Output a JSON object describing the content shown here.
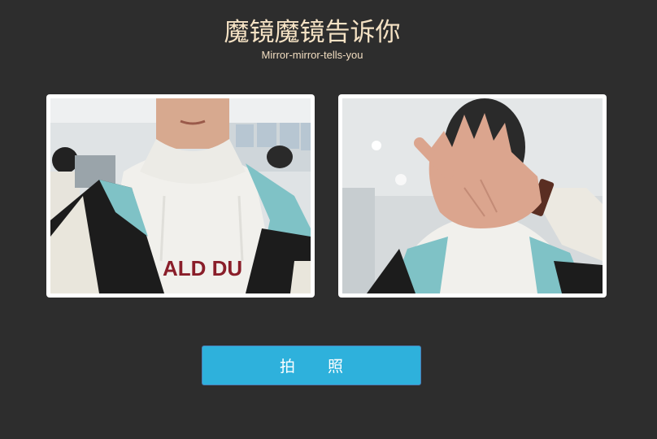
{
  "header": {
    "title": "魔镜魔镜告诉你",
    "subtitle": "Mirror-mirror-tells-you"
  },
  "camera": {
    "live_feed_label": "",
    "snapshot_label": ""
  },
  "actions": {
    "capture_label": "拍照"
  },
  "colors": {
    "background": "#2d2d2d",
    "title": "#f5e2c4",
    "button": "#2eb1dc",
    "button_border": "#4a7fb8"
  }
}
